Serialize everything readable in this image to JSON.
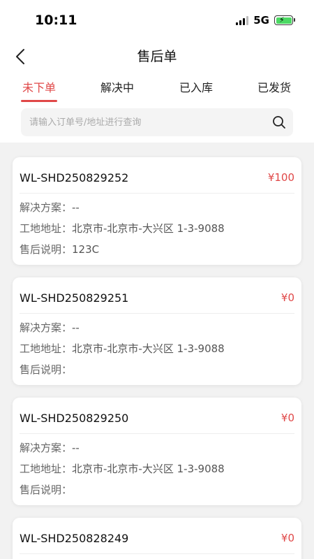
{
  "status_bar": {
    "time": "10:11",
    "network": "5G",
    "battery_icon": "battery-charging-icon"
  },
  "nav": {
    "title": "售后单",
    "back_icon": "chevron-left-icon"
  },
  "tabs": [
    {
      "label": "未下单",
      "active": true
    },
    {
      "label": "解决中",
      "active": false
    },
    {
      "label": "已入库",
      "active": false
    },
    {
      "label": "已发货",
      "active": false
    }
  ],
  "search": {
    "placeholder": "请输入订单号/地址进行查询",
    "value": "",
    "icon": "search-icon"
  },
  "labels": {
    "solution": "解决方案：",
    "address": "工地地址：",
    "note": "售后说明："
  },
  "colors": {
    "accent": "#e04848",
    "background": "#f2f2f2"
  },
  "orders": [
    {
      "order_no": "WL-SHD250829252",
      "amount": "¥100",
      "solution": "--",
      "address": "北京市-北京市-大兴区 1-3-9088",
      "note": "123C"
    },
    {
      "order_no": "WL-SHD250829251",
      "amount": "¥0",
      "solution": "--",
      "address": "北京市-北京市-大兴区 1-3-9088",
      "note": ""
    },
    {
      "order_no": "WL-SHD250829250",
      "amount": "¥0",
      "solution": "--",
      "address": "北京市-北京市-大兴区 1-3-9088",
      "note": ""
    },
    {
      "order_no": "WL-SHD250828249",
      "amount": "¥0",
      "solution": "",
      "address": "",
      "note": ""
    }
  ]
}
